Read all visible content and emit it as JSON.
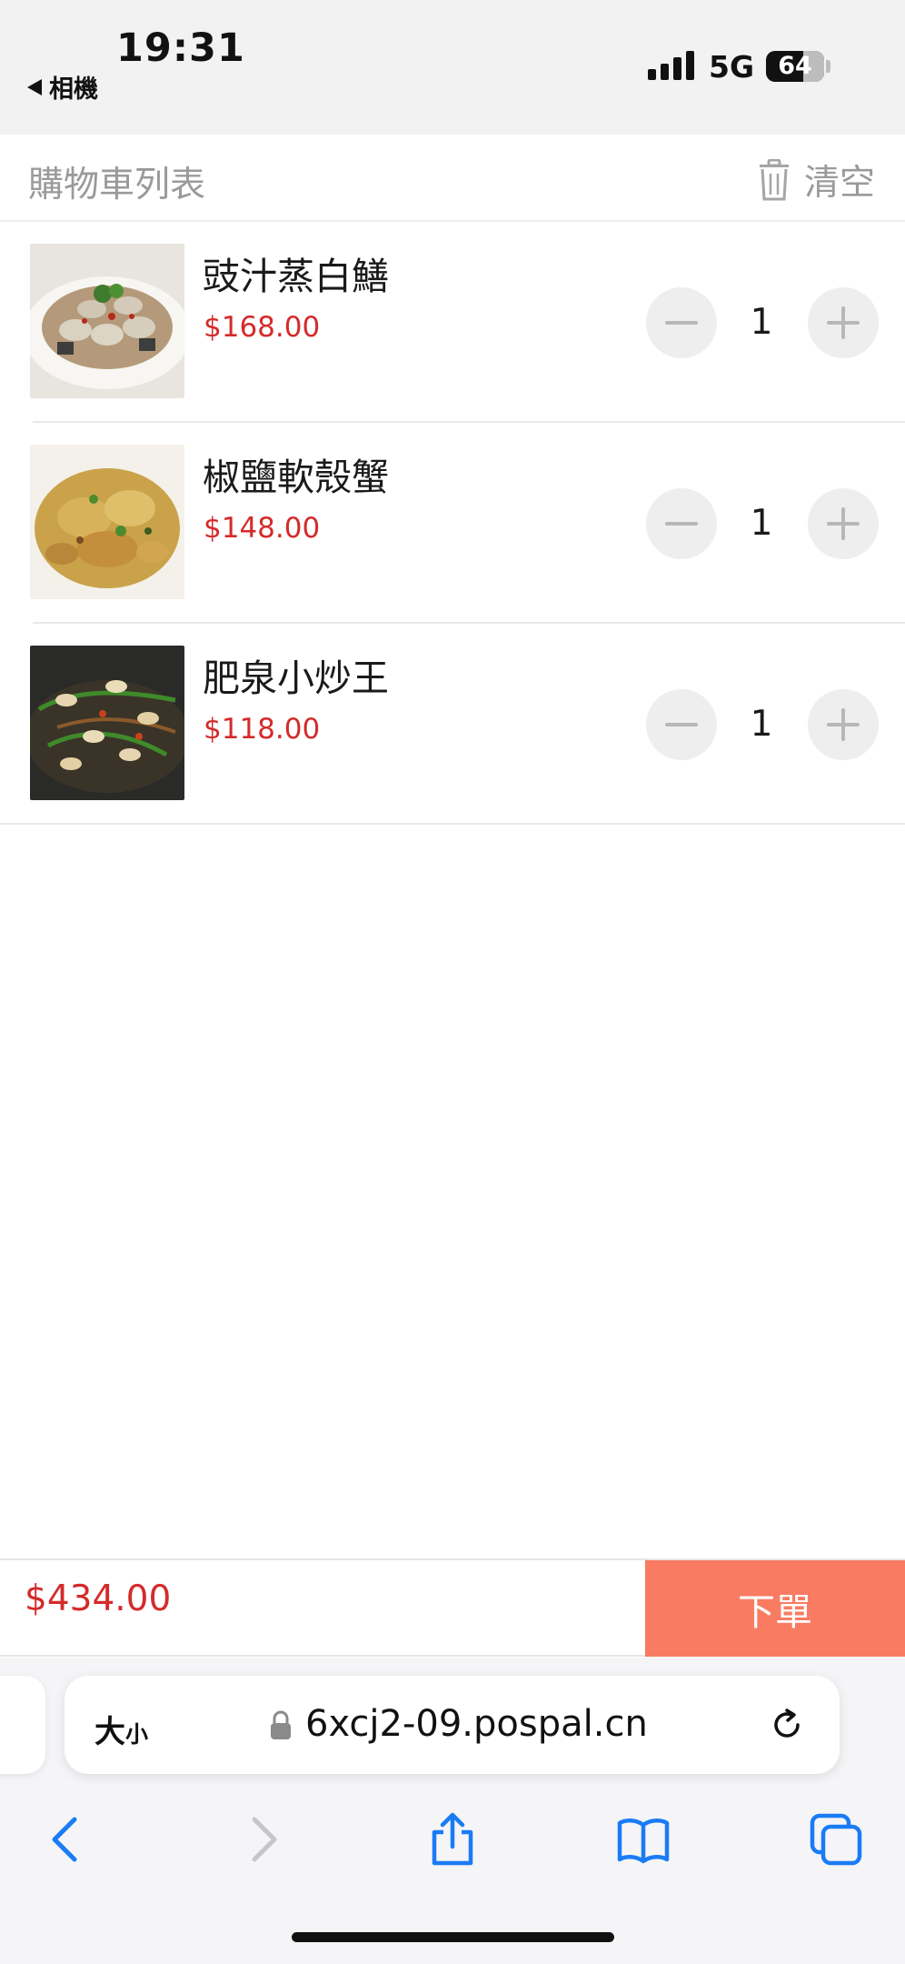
{
  "status_bar": {
    "time": "19:31",
    "back_app": "相機",
    "network": "5G",
    "battery": "64"
  },
  "header": {
    "title": "購物車列表",
    "clear_label": "清空"
  },
  "cart_items": [
    {
      "name": "豉汁蒸白鱔",
      "price": "$168.00",
      "quantity": "1",
      "image": "steamed-eel-dish"
    },
    {
      "name": "椒鹽軟殼蟹",
      "price": "$148.00",
      "quantity": "1",
      "image": "fried-soft-shell-crab-dish"
    },
    {
      "name": "肥泉小炒王",
      "price": "$118.00",
      "quantity": "1",
      "image": "stir-fry-cashew-dish"
    }
  ],
  "footer": {
    "total": "$434.00",
    "order_label": "下單"
  },
  "browser": {
    "text_size_label": "大",
    "text_size_small": "小",
    "url": "6xcj2-09.pospal.cn"
  },
  "icons": {
    "clear": "trash-icon",
    "back": "chevron-left-icon",
    "forward": "chevron-right-icon",
    "share": "share-icon",
    "bookmarks": "book-icon",
    "tabs": "tabs-icon"
  },
  "colors": {
    "price_red": "#d42b2b",
    "order_button": "#f87b62",
    "safari_blue": "#1a7cf5"
  }
}
